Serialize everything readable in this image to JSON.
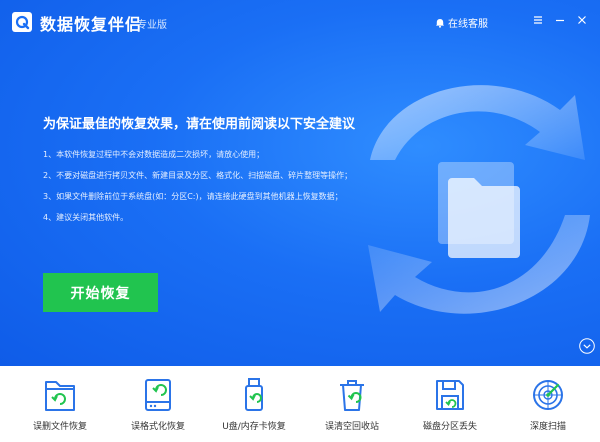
{
  "app": {
    "title": "数据恢复伴侣",
    "edition": "专业版",
    "service_label": "在线客服"
  },
  "icons": {
    "logo": "app-logo-icon",
    "service": "headset-icon",
    "menu": "menu-icon",
    "minimize": "minimize-icon",
    "close": "close-icon",
    "scroll": "chevron-down-icon",
    "hero": "folder-refresh-arrows-illustration"
  },
  "colors": {
    "hero_blue": "#1a6ff5",
    "hero_light": "#2f8dff",
    "start_green": "#21c44f",
    "tool_icon": "#2b74e8",
    "tool_arrow": "#21c44f"
  },
  "main": {
    "headline": "为保证最佳的恢复效果，请在使用前阅读以下安全建议",
    "tips": [
      "1、本软件恢复过程中不会对数据造成二次损坏，请放心使用；",
      "2、不要对磁盘进行拷贝文件、新建目录及分区、格式化、扫描磁盘、碎片整理等操作；",
      "3、如果文件删除前位于系统盘(如：分区C:)，请连接此硬盘到其他机器上恢复数据；",
      "4、建议关闭其他软件。"
    ],
    "start_button": "开始恢复"
  },
  "tools": [
    {
      "label": "误删文件恢复",
      "icon": "folder-restore-icon"
    },
    {
      "label": "误格式化恢复",
      "icon": "hard-drive-restore-icon"
    },
    {
      "label": "U盘/内存卡恢复",
      "icon": "usb-drive-restore-icon"
    },
    {
      "label": "误清空回收站",
      "icon": "recycle-bin-restore-icon"
    },
    {
      "label": "磁盘分区丢失",
      "icon": "floppy-disk-restore-icon"
    },
    {
      "label": "深度扫描",
      "icon": "radar-scan-icon"
    }
  ]
}
